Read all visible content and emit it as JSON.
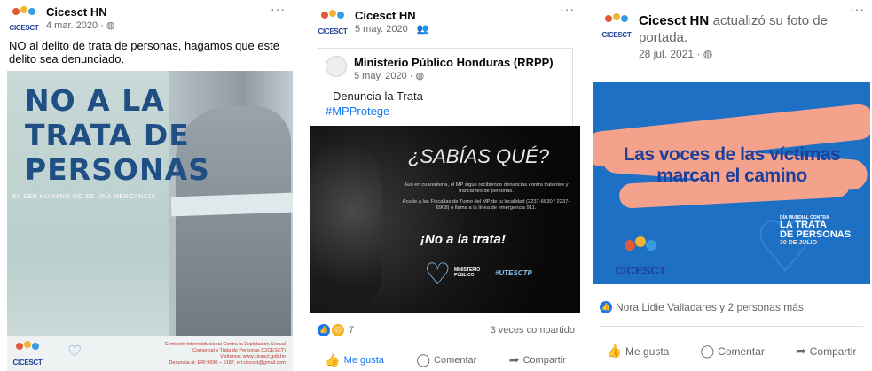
{
  "posts": [
    {
      "author": "Cicesct HN",
      "date": "4 mar. 2020 ·",
      "menu": "···",
      "text": "NO al delito de trata de personas, hagamos que este delito sea denunciado.",
      "image": {
        "headline": [
          "NO A LA",
          "TRATA DE",
          "PERSONAS"
        ],
        "subline": "EL SER HUMANO NO ES UNA MERCANCÍA",
        "logo_text": "CICESCT",
        "footer_lines": [
          "Comisión Interinstitucional Contra la Explotación Sexual",
          "Comercial y Trata de Personas (CICESCT)",
          "Visítanos: www.cicesct.gob.hn",
          "Denuncia al: ERI 9990 – 5187, eri.cicesct@gmail.com"
        ]
      }
    },
    {
      "author": "Cicesct HN",
      "date": "5 may. 2020 ·",
      "menu": "···",
      "shared": {
        "author": "Ministerio Público Honduras (RRPP)",
        "date": "5 may. 2020 ·",
        "text": "- Denuncia la Trata -",
        "hashtag": "#MPProtege"
      },
      "image": {
        "question": "¿SABÍAS QUÉ?",
        "para1": "Aun en cuarentena, el MP sigue recibiendo denuncias contra tratantes y traficantes de personas.",
        "para2": "Acude a las Fiscalías de Turno del MP de tu localidad (2237-6830 / 2237-6908) o llama a la línea de emergencia 911.",
        "slogan": "¡No a la trata!",
        "mp_label_1": "MINISTERIO",
        "mp_label_2": "PÚBLICO",
        "tag": "#UTESCTP"
      },
      "reactions_count": "7",
      "shares": "3 veces compartido",
      "actions": [
        "Me gusta",
        "Comentar",
        "Compartir"
      ]
    },
    {
      "author": "Cicesct HN",
      "action_text": "actualizó su foto de portada.",
      "date": "28 jul. 2021 ·",
      "menu": "···",
      "image": {
        "headline": [
          "Las voces de las víctimas",
          "marcan el camino"
        ],
        "day_small": "DÍA MUNDIAL CONTRA",
        "day_big_1": "LA TRATA",
        "day_big_2": "DE PERSONAS",
        "day_date": "30 DE JULIO",
        "logo_text": "CICESCT"
      },
      "likes": "Nora Lidie Valladares y 2 personas más",
      "actions": [
        "Me gusta",
        "Comentar",
        "Compartir"
      ]
    }
  ],
  "colors": {
    "fb_blue": "#1877f2",
    "meta_gray": "#65676b",
    "poster_blue": "#1f4f85",
    "cover_blue": "#1e70c4",
    "cover_salmon": "#f5a28c"
  },
  "icons": [
    "globe-icon",
    "friends-icon",
    "like-icon",
    "comment-icon",
    "share-icon",
    "heart-icon"
  ]
}
